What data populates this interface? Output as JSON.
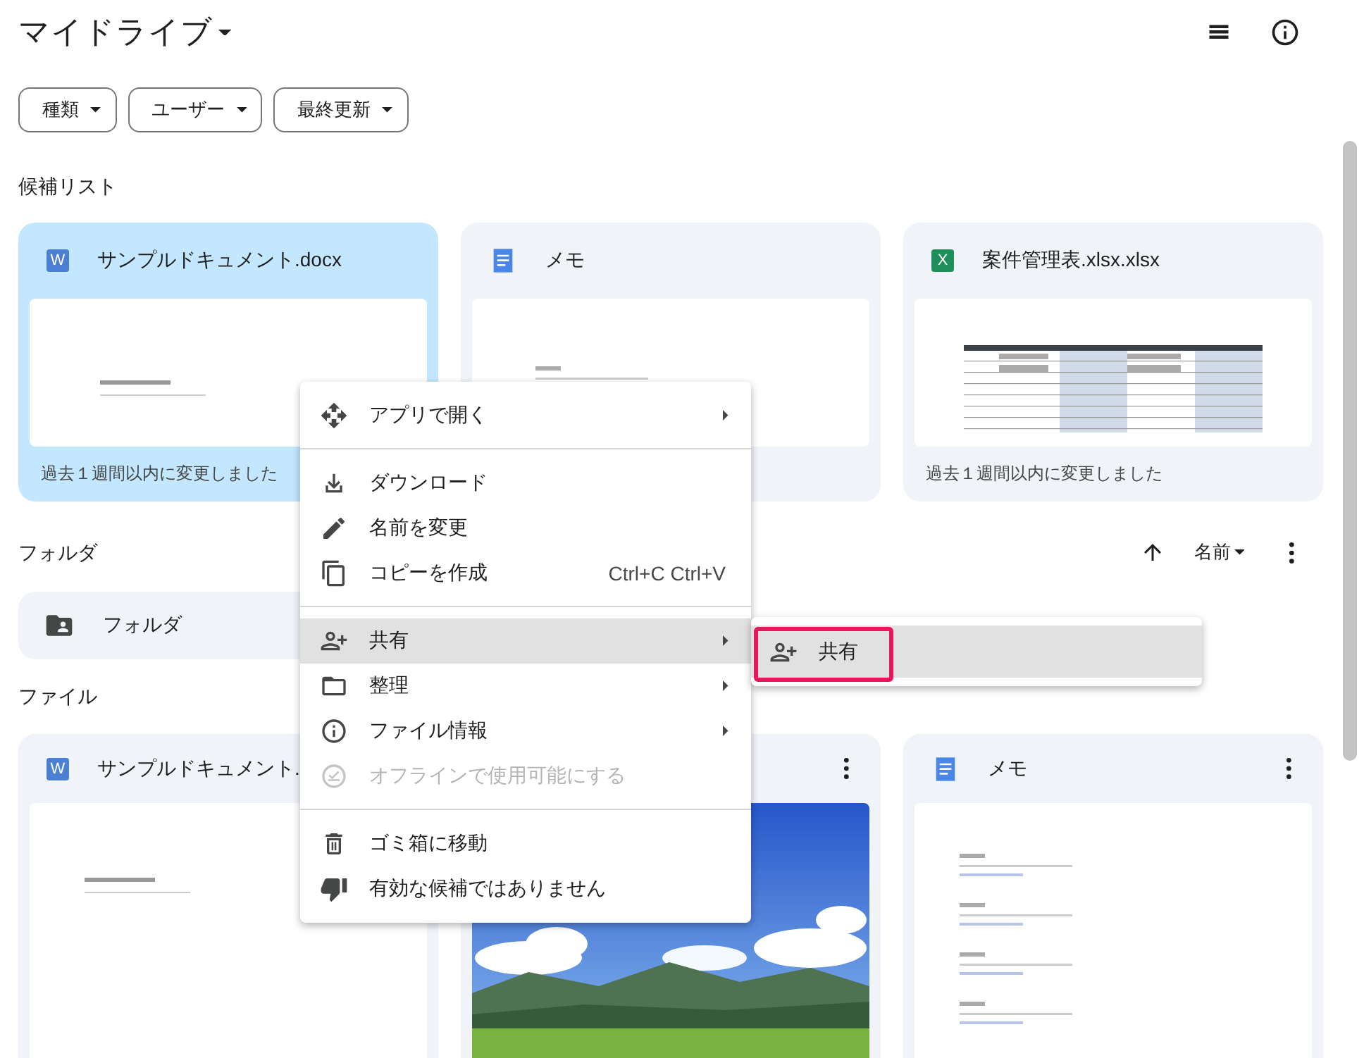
{
  "header": {
    "title": "マイドライブ"
  },
  "filters": [
    {
      "label": "種類"
    },
    {
      "label": "ユーザー"
    },
    {
      "label": "最終更新"
    }
  ],
  "suggested": {
    "heading": "候補リスト",
    "cards": [
      {
        "kind": "word",
        "badge": "W",
        "name": "サンプルドキュメント.docx",
        "selected": true,
        "preview": {
          "kind": "doc"
        },
        "footer": "過去１週間以内に変更しました"
      },
      {
        "kind": "docs",
        "name": "メモ",
        "selected": false,
        "preview": {
          "kind": "memo"
        }
      },
      {
        "kind": "excel",
        "badge": "X",
        "name": "案件管理表.xlsx.xlsx",
        "selected": false,
        "preview": {
          "kind": "sheet"
        },
        "footer": "過去１週間以内に変更しました"
      }
    ]
  },
  "folders": {
    "heading": "フォルダ",
    "sort_label": "名前",
    "items": [
      {
        "name": "フォルダ"
      }
    ]
  },
  "files": {
    "heading": "ファイル",
    "cards": [
      {
        "kind": "word",
        "badge": "W",
        "name": "サンプルドキュメント.",
        "preview": {
          "kind": "doc"
        }
      },
      {
        "kind": "hidden",
        "more": true
      },
      {
        "kind": "docs",
        "name": "メモ",
        "more": true,
        "preview": {
          "kind": "memo"
        }
      }
    ]
  },
  "context_menu": {
    "items": [
      {
        "kind": "item",
        "label": "アプリで開く",
        "submenu": true,
        "selected": false,
        "disabled": false
      },
      {
        "kind": "divider"
      },
      {
        "kind": "item",
        "label": "ダウンロード",
        "submenu": false,
        "selected": false,
        "disabled": false
      },
      {
        "kind": "item",
        "label": "名前を変更",
        "submenu": false,
        "selected": false,
        "disabled": false
      },
      {
        "kind": "item",
        "label": "コピーを作成",
        "shortcut": "Ctrl+C Ctrl+V",
        "submenu": false,
        "selected": false,
        "disabled": false
      },
      {
        "kind": "divider"
      },
      {
        "kind": "item",
        "label": "共有",
        "submenu": true,
        "selected": true,
        "disabled": false
      },
      {
        "kind": "item",
        "label": "整理",
        "submenu": true,
        "selected": false,
        "disabled": false
      },
      {
        "kind": "item",
        "label": "ファイル情報",
        "submenu": true,
        "selected": false,
        "disabled": false
      },
      {
        "kind": "item",
        "label": "オフラインで使用可能にする",
        "submenu": false,
        "selected": false,
        "disabled": true
      },
      {
        "kind": "divider"
      },
      {
        "kind": "item",
        "label": "ゴミ箱に移動",
        "submenu": false,
        "selected": false,
        "disabled": false
      },
      {
        "kind": "item",
        "label": "有効な候補ではありません",
        "submenu": false,
        "selected": false,
        "disabled": false
      }
    ]
  },
  "submenu": {
    "items": [
      {
        "label": "共有",
        "selected": true,
        "annotated": true
      }
    ]
  }
}
